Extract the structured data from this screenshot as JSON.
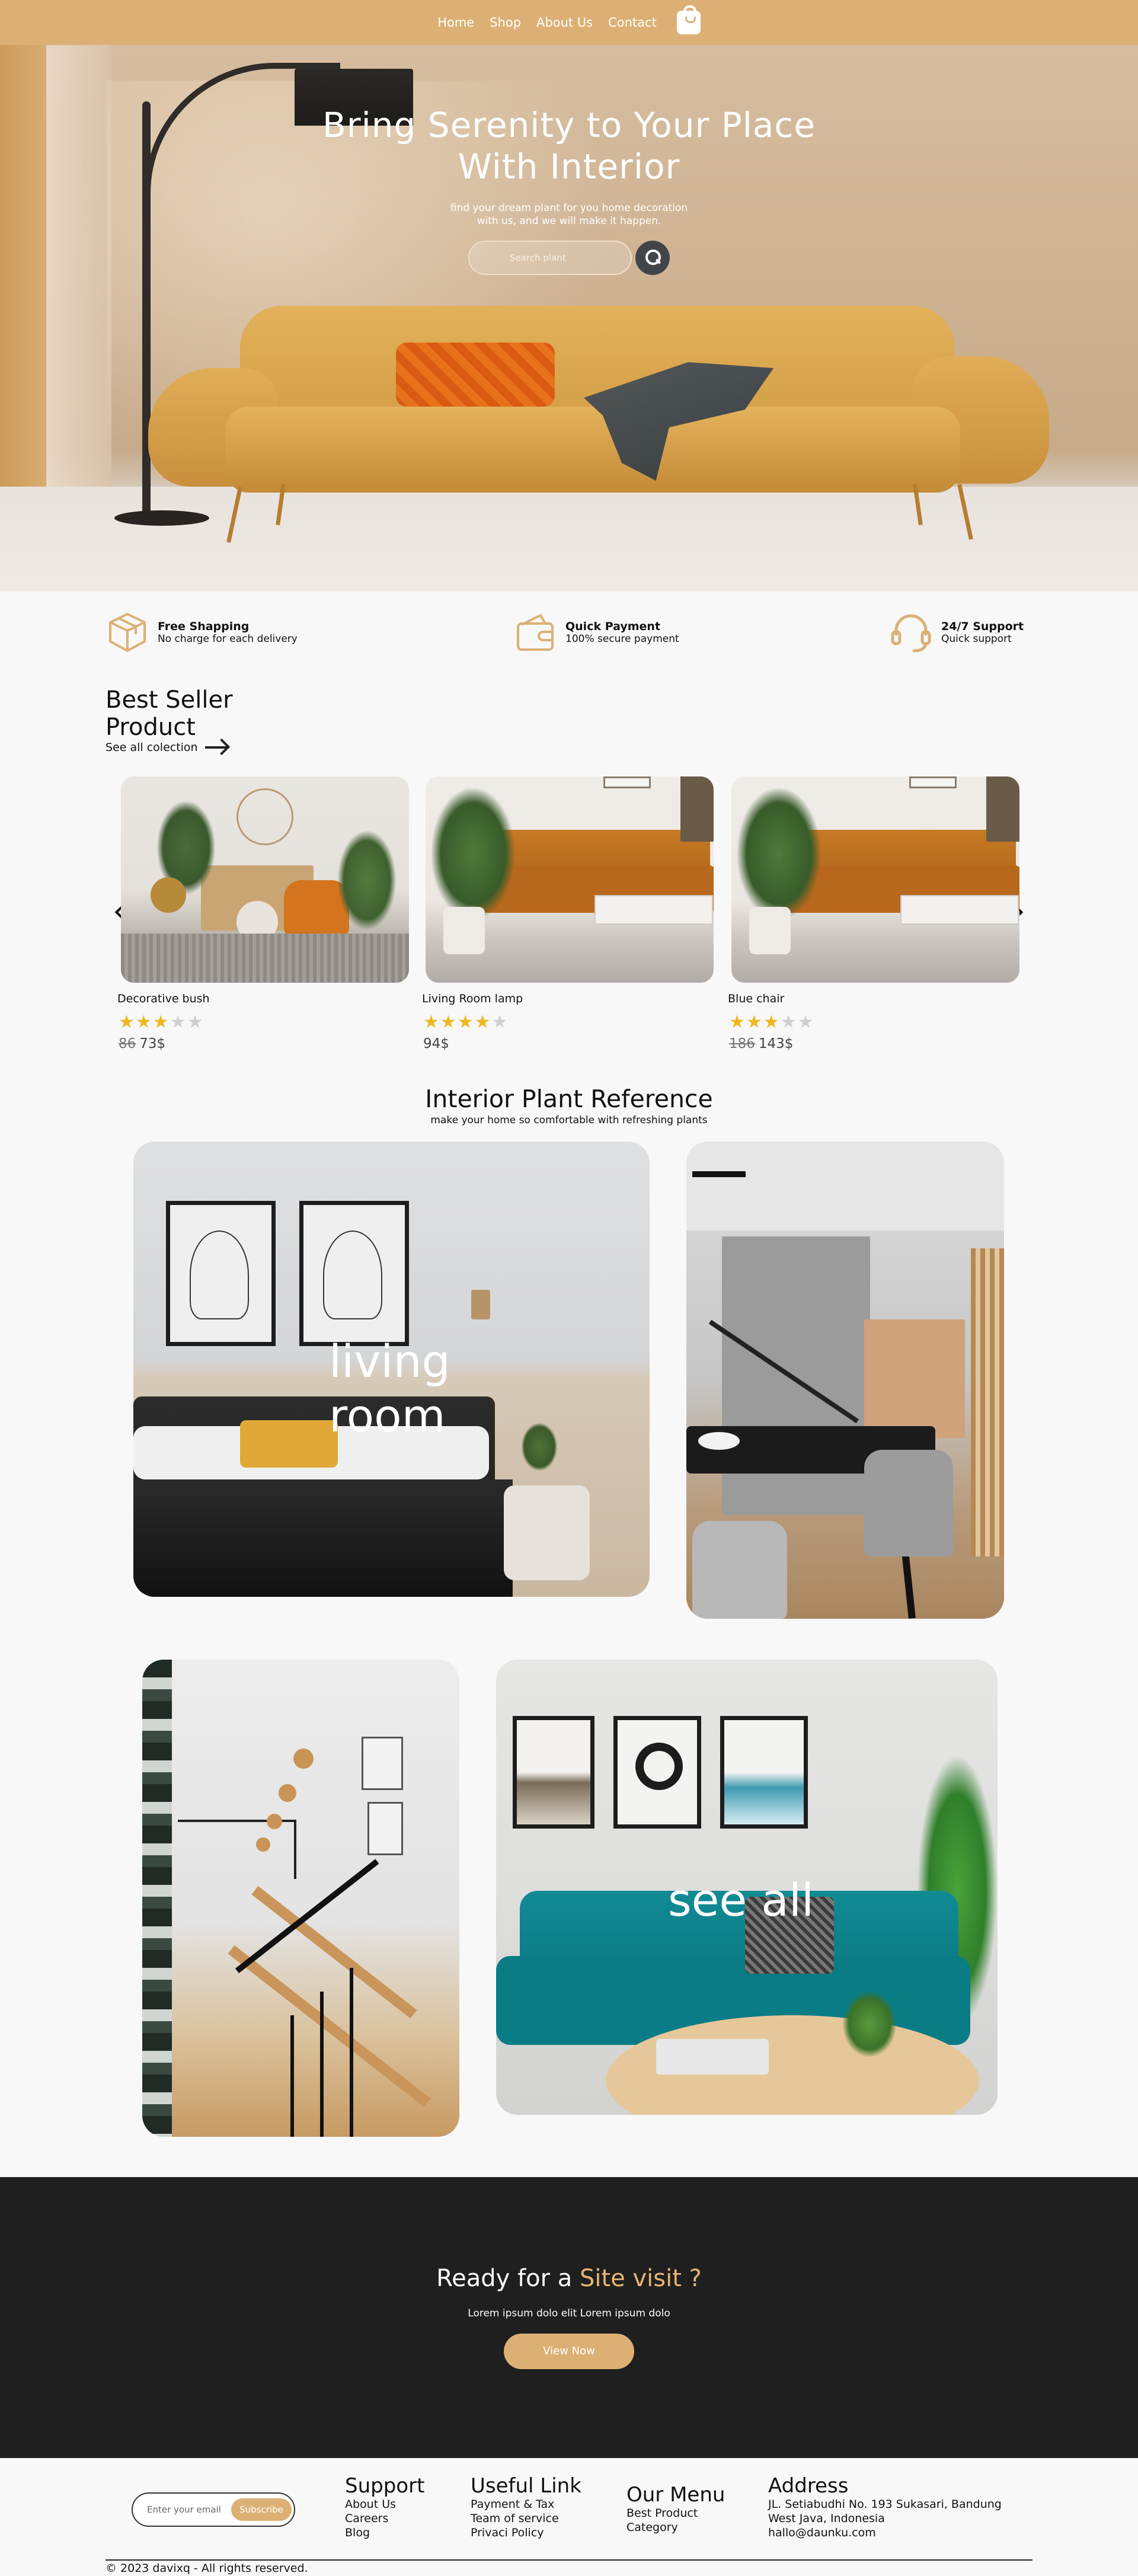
{
  "nav": {
    "items": [
      "Home",
      "Shop",
      "About Us",
      "Contact"
    ],
    "bag_icon": "shopping-bag-icon"
  },
  "hero": {
    "title_line1": "Bring Serenity to Your Place",
    "title_line2": "With Interior",
    "subtitle_line1": "find your dream plant for you home decoration",
    "subtitle_line2": "with us, and we will make it happen.",
    "search_placeholder": "Search plant",
    "search_icon": "search-icon"
  },
  "features": [
    {
      "title": "Free Shapping",
      "desc": "No charge for each delivery",
      "icon": "box-icon"
    },
    {
      "title": "Quick Payment",
      "desc": "100% secure payment",
      "icon": "wallet-icon"
    },
    {
      "title": "24/7 Support",
      "desc": "Quick support",
      "icon": "headset-icon"
    }
  ],
  "best_seller": {
    "title_line1": "Best Seller",
    "title_line2": "Product",
    "see_all": "See all colection",
    "products": [
      {
        "name": "Decorative bush",
        "rating": 3,
        "old_price": "86",
        "price": "73$"
      },
      {
        "name": "Living Room lamp",
        "rating": 4,
        "old_price": "",
        "price": "94$"
      },
      {
        "name": "Blue chair",
        "rating": 3,
        "old_price": "186",
        "price": "143$"
      }
    ]
  },
  "references": {
    "title": "Interior Plant Reference",
    "subtitle": "make your home so comfortable with refreshing plants",
    "living_line1": "living",
    "living_line2": "room",
    "see_all": "see all"
  },
  "cta": {
    "title_start": "Ready for a ",
    "title_highlight": "Site visit ?",
    "text": "Lorem ipsum dolo elit Lorem ipsum dolo",
    "button": "View Now"
  },
  "footer": {
    "email_placeholder": "Enter your email",
    "subscribe": "Subscribe",
    "support": {
      "title": "Support",
      "links": [
        "About Us",
        "Careers",
        "Blog"
      ]
    },
    "useful": {
      "title": "Useful Link",
      "links": [
        "Payment & Tax",
        "Team of service",
        "Privaci Policy"
      ]
    },
    "menu": {
      "title": "Our Menu",
      "links": [
        "Best Product",
        "Category"
      ]
    },
    "address": {
      "title": "Address",
      "lines": [
        "JL. Setiabudhi No. 193 Sukasari, Bandung",
        "West Java, Indonesia",
        "hallo@daunku.com"
      ]
    },
    "copyright": "© 2023 davixq - All rights reserved."
  },
  "colors": {
    "accent": "#dcb074",
    "dark": "#1f1f1f",
    "star": "#efb720",
    "highlight": "#e7b474"
  }
}
